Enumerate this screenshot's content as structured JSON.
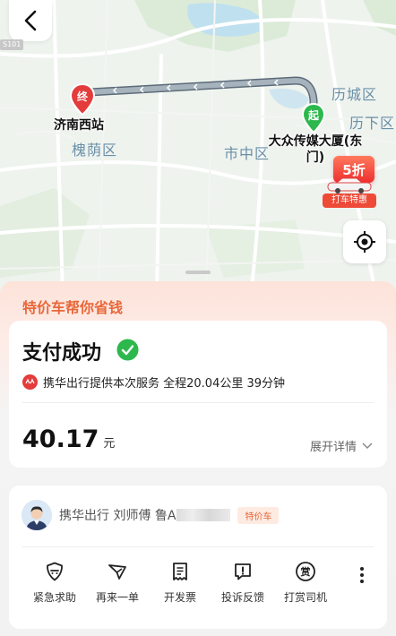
{
  "map": {
    "road_tag": "S101",
    "districts": {
      "lixia_top": "历城区",
      "lixia": "历下区",
      "huaiyin": "槐荫区",
      "shizhong": "市中区"
    },
    "start_pin": "起",
    "end_pin": "终",
    "start_place": "大众传媒大厦(东门)",
    "start_place_line1": "大众传媒大厦(东",
    "start_place_line2": "门)",
    "end_place": "济南西站",
    "promo": {
      "badge": "5折",
      "label": "打车特惠"
    },
    "icons": {
      "back": "chevron-left-icon",
      "locate": "locate-icon"
    }
  },
  "sheet": {
    "banner": "特价车帮你省钱",
    "payment": {
      "title": "支付成功",
      "service_text": "携华出行提供本次服务 全程20.04公里 39分钟",
      "price": "40.17",
      "currency": "元",
      "detail_link": "展开详情"
    },
    "driver": {
      "info": "携华出行 刘师傅 鲁A",
      "car_type": "特价车"
    },
    "actions": [
      {
        "label": "紧急求助",
        "icon": "shield-alert-icon"
      },
      {
        "label": "再来一单",
        "icon": "send-again-icon"
      },
      {
        "label": "开发票",
        "icon": "invoice-icon"
      },
      {
        "label": "投诉反馈",
        "icon": "complaint-icon"
      },
      {
        "label": "打赏司机",
        "icon": "tip-icon"
      }
    ],
    "tip_glyph": "赏"
  },
  "colors": {
    "accent": "#e8683a",
    "success": "#2db84d",
    "route": "#8a9aa6",
    "pin_red": "#e43b3b",
    "pin_green": "#2db84d"
  }
}
